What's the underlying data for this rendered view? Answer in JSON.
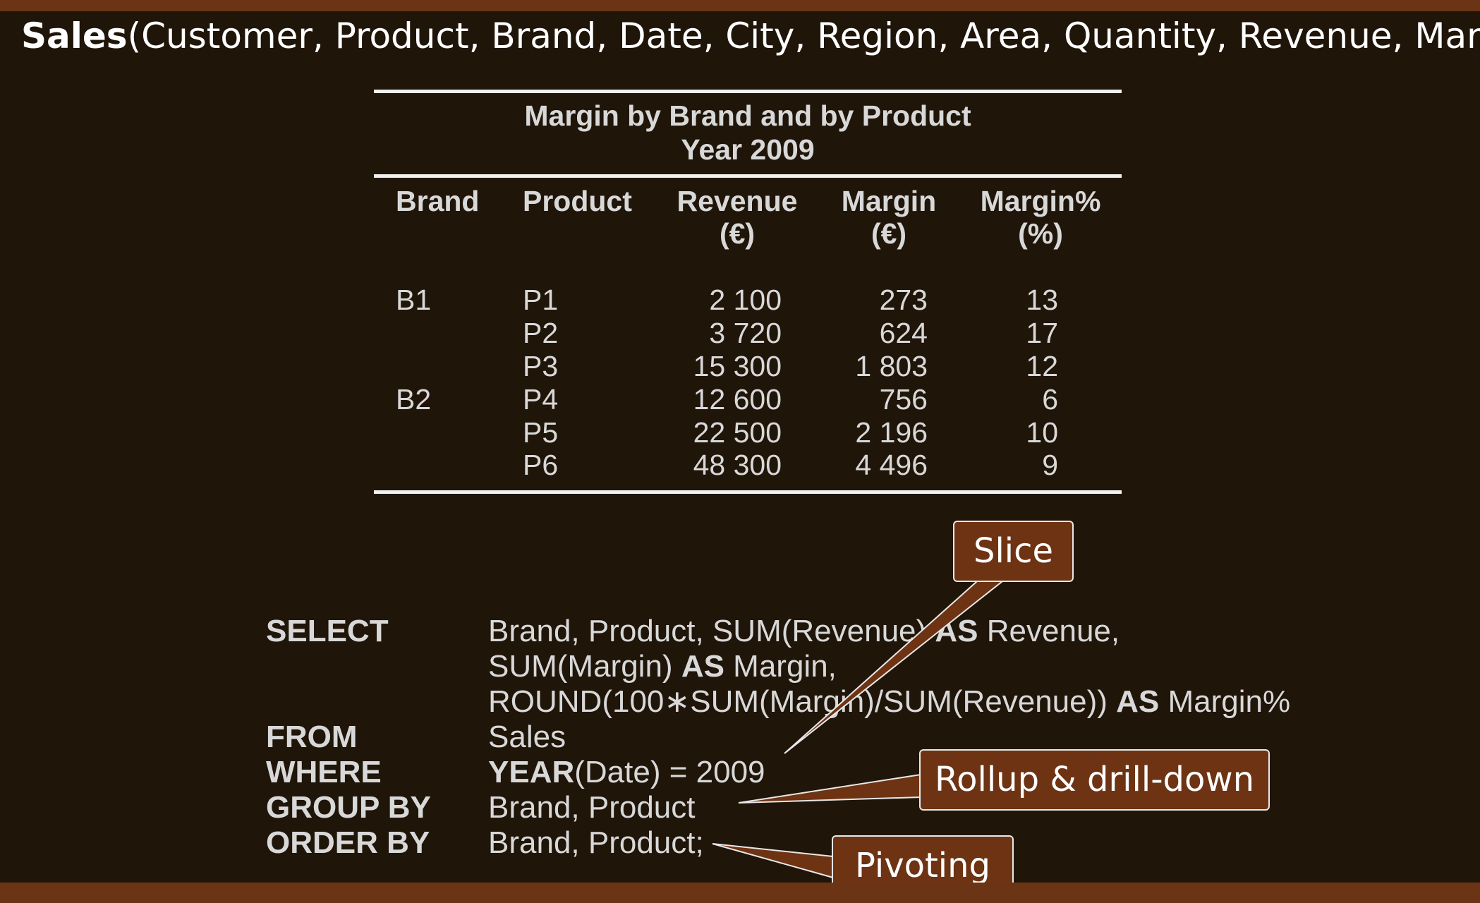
{
  "header": {
    "title_bold": "Sales",
    "title_rest": "(Customer, Product, Brand, Date, City, Region, Area, Quantity, Revenue, Margin)"
  },
  "table": {
    "caption_line1": "Margin by Brand and by Product",
    "caption_line2": "Year 2009",
    "columns": [
      {
        "label": "Brand",
        "unit": ""
      },
      {
        "label": "Product",
        "unit": ""
      },
      {
        "label": "Revenue",
        "unit": "(€)"
      },
      {
        "label": "Margin",
        "unit": "(€)"
      },
      {
        "label": "Margin%",
        "unit": "(%)"
      }
    ],
    "rows": [
      {
        "brand": "B1",
        "product": "P1",
        "revenue": "2 100",
        "margin": "273",
        "margin_pct": "13"
      },
      {
        "brand": "",
        "product": "P2",
        "revenue": "3 720",
        "margin": "624",
        "margin_pct": "17"
      },
      {
        "brand": "",
        "product": "P3",
        "revenue": "15 300",
        "margin": "1 803",
        "margin_pct": "12"
      },
      {
        "brand": "B2",
        "product": "P4",
        "revenue": "12 600",
        "margin": "756",
        "margin_pct": "6"
      },
      {
        "brand": "",
        "product": "P5",
        "revenue": "22 500",
        "margin": "2 196",
        "margin_pct": "10"
      },
      {
        "brand": "",
        "product": "P6",
        "revenue": "48 300",
        "margin": "4 496",
        "margin_pct": "9"
      }
    ]
  },
  "sql": {
    "select_kw": "SELECT",
    "select_line1_a": "Brand, Product, SUM(Revenue)",
    "as_kw": "AS",
    "select_line1_b": "Revenue,",
    "select_line2_a": "SUM(Margin)",
    "select_line2_b": "Margin,",
    "select_line3_a": "ROUND(100∗SUM(Margin)/SUM(Revenue))",
    "select_line3_b": "Margin%",
    "from_kw": "FROM",
    "from_value": "Sales",
    "where_kw": "WHERE",
    "where_fn": "YEAR",
    "where_rest": "(Date) = 2009",
    "groupby_kw": "GROUP BY",
    "groupby_value": "Brand, Product",
    "orderby_kw": "ORDER BY",
    "orderby_value": "Brand, Product;"
  },
  "callouts": {
    "slice": "Slice",
    "rollup": "Rollup & drill-down",
    "pivoting": "Pivoting"
  },
  "colors": {
    "background": "#201509",
    "accent_bar": "#6b3415",
    "callout_fill": "#6e3313"
  }
}
